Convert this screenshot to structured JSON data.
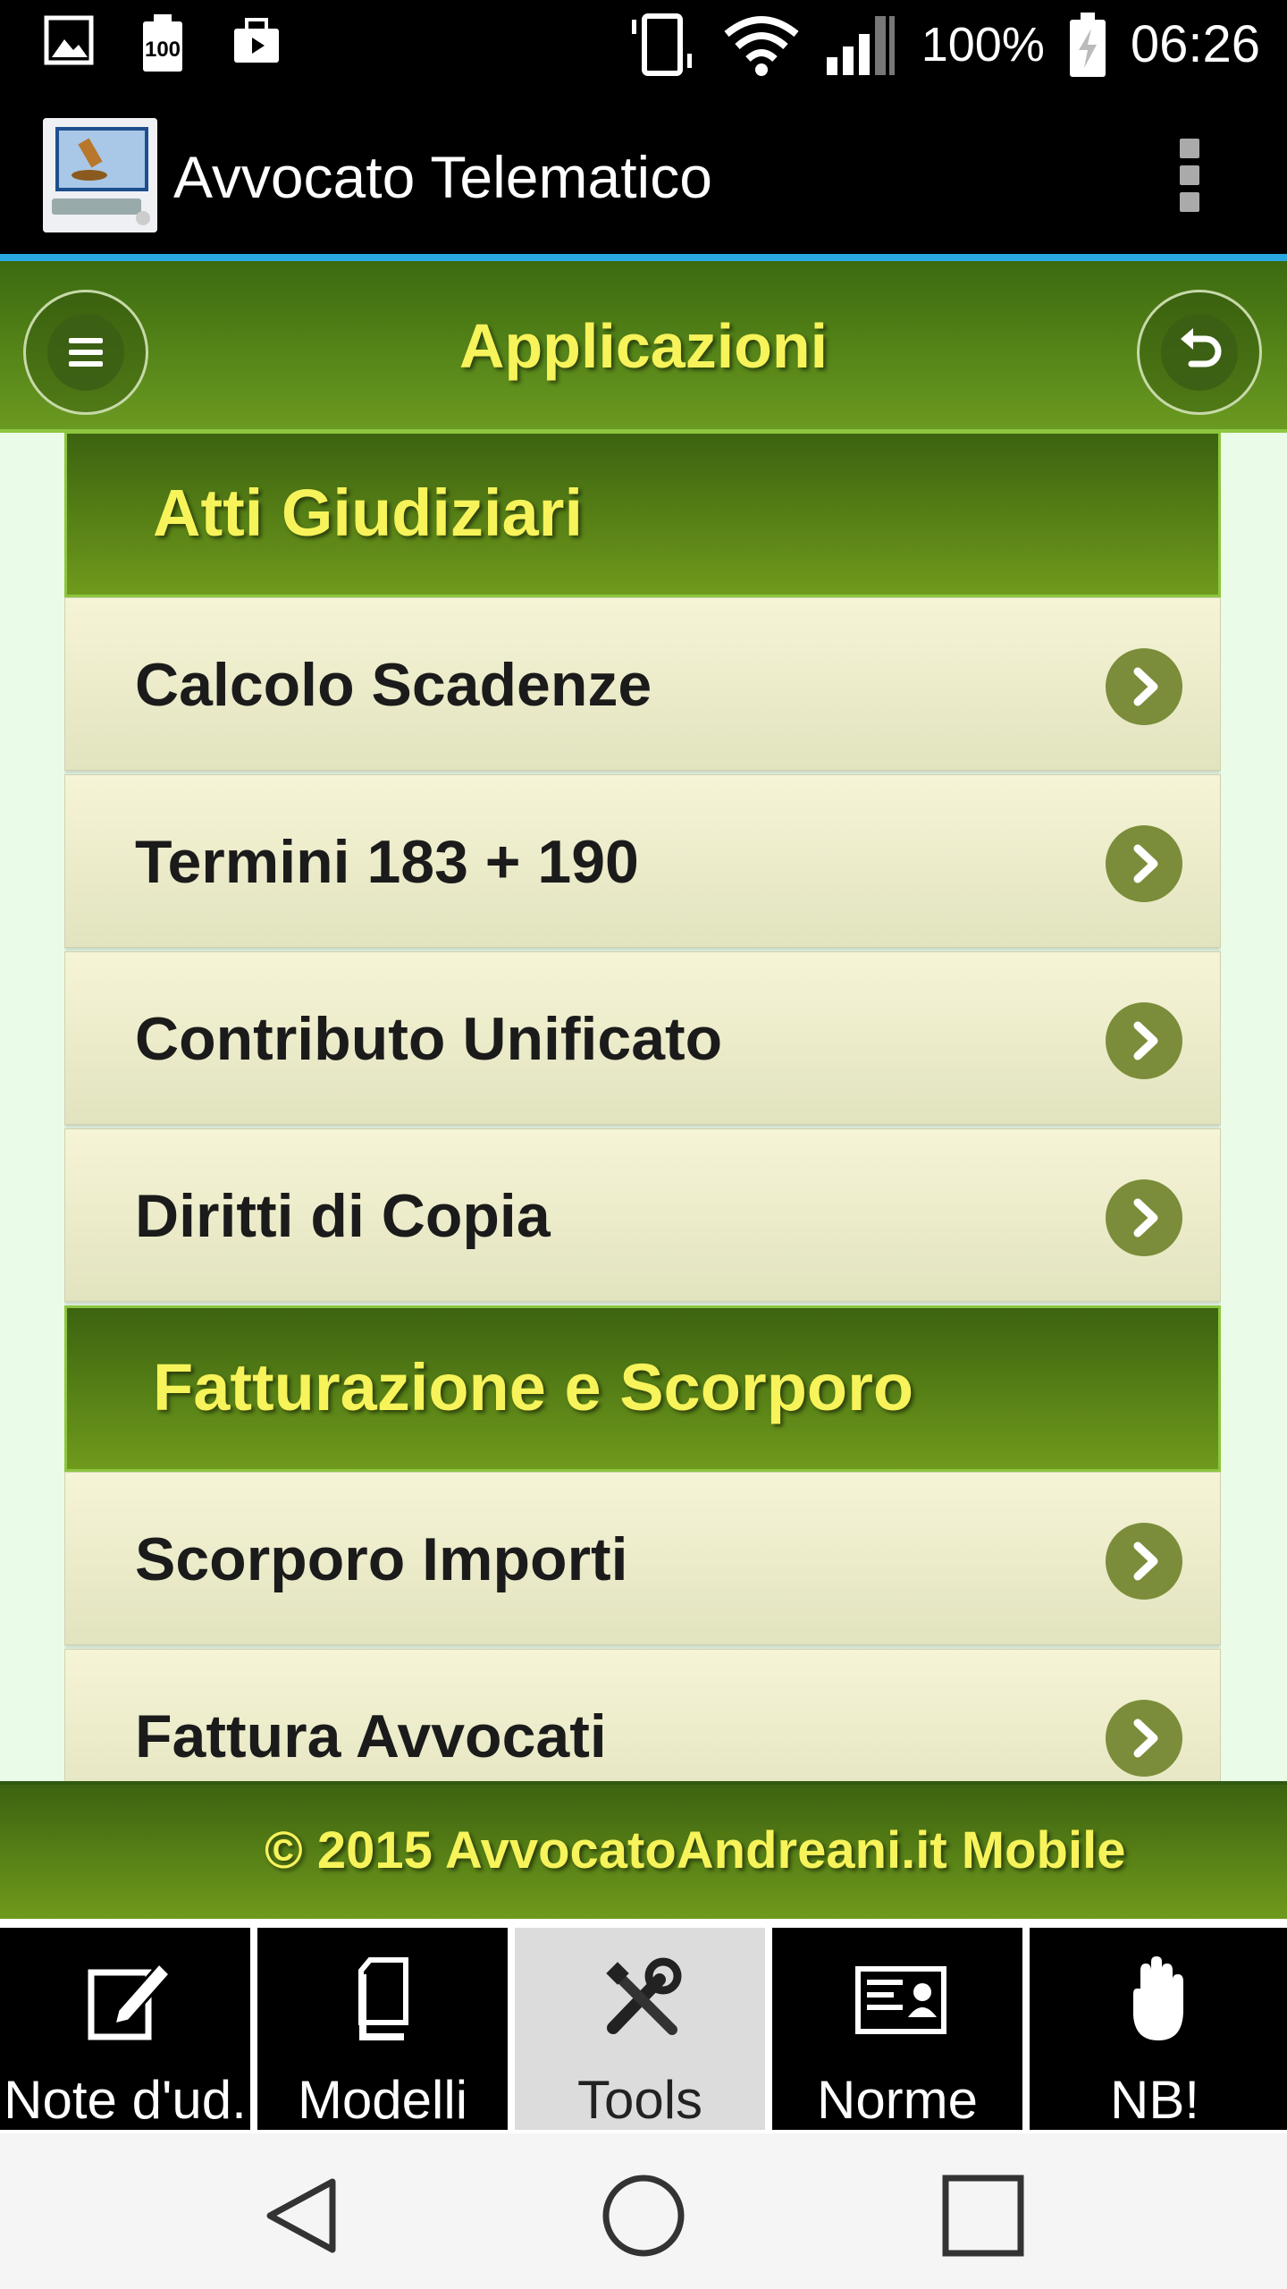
{
  "status_bar": {
    "battery_percent": "100%",
    "time": "06:26",
    "notif_battery_label": "100",
    "icons": [
      "image-icon",
      "battery-notification-icon",
      "briefcase-icon",
      "vibrate-icon",
      "wifi-icon",
      "signal-icon",
      "battery-icon"
    ]
  },
  "action_bar": {
    "title": "Avvocato Telematico",
    "icons": [
      "app-logo-icon",
      "overflow-menu-icon"
    ]
  },
  "header": {
    "title": "Applicazioni",
    "icons": [
      "hamburger-menu-icon",
      "back-arrow-icon"
    ]
  },
  "sections": [
    {
      "title": "Atti Giudiziari",
      "items": [
        "Calcolo Scadenze",
        "Termini 183 + 190",
        "Contributo Unificato",
        "Diritti di Copia"
      ]
    },
    {
      "title": "Fatturazione e Scorporo",
      "items": [
        "Scorporo Importi",
        "Fattura Avvocati"
      ]
    }
  ],
  "footer": {
    "copyright": "© 2015 AvvocatoAndreani.it Mobile"
  },
  "tabs": [
    {
      "label": "Note d'ud.",
      "icon": "edit-note-icon",
      "active": false
    },
    {
      "label": "Modelli",
      "icon": "documents-icon",
      "active": false
    },
    {
      "label": "Tools",
      "icon": "tools-icon",
      "active": true
    },
    {
      "label": "Norme",
      "icon": "id-card-icon",
      "active": false
    },
    {
      "label": "NB!",
      "icon": "hand-icon",
      "active": false
    }
  ],
  "nav_bar": {
    "icons": [
      "back-triangle-icon",
      "home-circle-icon",
      "recents-square-icon"
    ]
  },
  "colors": {
    "accent_yellow": "#f7f35a",
    "header_green": "#4f7d14",
    "status_blue": "#29a9e0",
    "chevron_green": "#7b8d3a"
  }
}
